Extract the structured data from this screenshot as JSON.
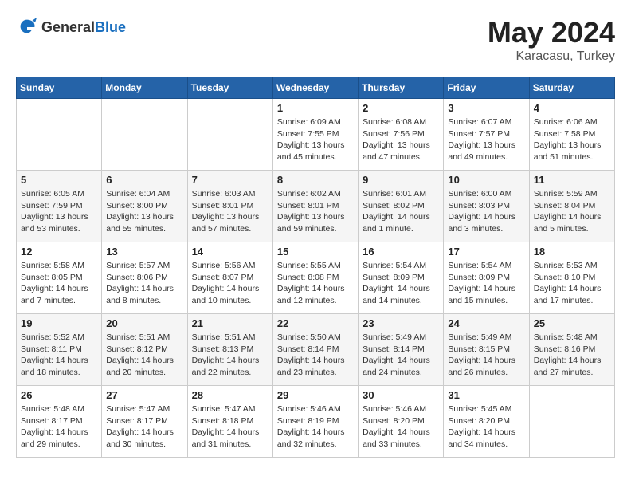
{
  "header": {
    "logo_general": "General",
    "logo_blue": "Blue",
    "title": "May 2024",
    "location": "Karacasu, Turkey"
  },
  "weekdays": [
    "Sunday",
    "Monday",
    "Tuesday",
    "Wednesday",
    "Thursday",
    "Friday",
    "Saturday"
  ],
  "weeks": [
    [
      {
        "day": "",
        "info": ""
      },
      {
        "day": "",
        "info": ""
      },
      {
        "day": "",
        "info": ""
      },
      {
        "day": "1",
        "info": "Sunrise: 6:09 AM\nSunset: 7:55 PM\nDaylight: 13 hours\nand 45 minutes."
      },
      {
        "day": "2",
        "info": "Sunrise: 6:08 AM\nSunset: 7:56 PM\nDaylight: 13 hours\nand 47 minutes."
      },
      {
        "day": "3",
        "info": "Sunrise: 6:07 AM\nSunset: 7:57 PM\nDaylight: 13 hours\nand 49 minutes."
      },
      {
        "day": "4",
        "info": "Sunrise: 6:06 AM\nSunset: 7:58 PM\nDaylight: 13 hours\nand 51 minutes."
      }
    ],
    [
      {
        "day": "5",
        "info": "Sunrise: 6:05 AM\nSunset: 7:59 PM\nDaylight: 13 hours\nand 53 minutes."
      },
      {
        "day": "6",
        "info": "Sunrise: 6:04 AM\nSunset: 8:00 PM\nDaylight: 13 hours\nand 55 minutes."
      },
      {
        "day": "7",
        "info": "Sunrise: 6:03 AM\nSunset: 8:01 PM\nDaylight: 13 hours\nand 57 minutes."
      },
      {
        "day": "8",
        "info": "Sunrise: 6:02 AM\nSunset: 8:01 PM\nDaylight: 13 hours\nand 59 minutes."
      },
      {
        "day": "9",
        "info": "Sunrise: 6:01 AM\nSunset: 8:02 PM\nDaylight: 14 hours\nand 1 minute."
      },
      {
        "day": "10",
        "info": "Sunrise: 6:00 AM\nSunset: 8:03 PM\nDaylight: 14 hours\nand 3 minutes."
      },
      {
        "day": "11",
        "info": "Sunrise: 5:59 AM\nSunset: 8:04 PM\nDaylight: 14 hours\nand 5 minutes."
      }
    ],
    [
      {
        "day": "12",
        "info": "Sunrise: 5:58 AM\nSunset: 8:05 PM\nDaylight: 14 hours\nand 7 minutes."
      },
      {
        "day": "13",
        "info": "Sunrise: 5:57 AM\nSunset: 8:06 PM\nDaylight: 14 hours\nand 8 minutes."
      },
      {
        "day": "14",
        "info": "Sunrise: 5:56 AM\nSunset: 8:07 PM\nDaylight: 14 hours\nand 10 minutes."
      },
      {
        "day": "15",
        "info": "Sunrise: 5:55 AM\nSunset: 8:08 PM\nDaylight: 14 hours\nand 12 minutes."
      },
      {
        "day": "16",
        "info": "Sunrise: 5:54 AM\nSunset: 8:09 PM\nDaylight: 14 hours\nand 14 minutes."
      },
      {
        "day": "17",
        "info": "Sunrise: 5:54 AM\nSunset: 8:09 PM\nDaylight: 14 hours\nand 15 minutes."
      },
      {
        "day": "18",
        "info": "Sunrise: 5:53 AM\nSunset: 8:10 PM\nDaylight: 14 hours\nand 17 minutes."
      }
    ],
    [
      {
        "day": "19",
        "info": "Sunrise: 5:52 AM\nSunset: 8:11 PM\nDaylight: 14 hours\nand 18 minutes."
      },
      {
        "day": "20",
        "info": "Sunrise: 5:51 AM\nSunset: 8:12 PM\nDaylight: 14 hours\nand 20 minutes."
      },
      {
        "day": "21",
        "info": "Sunrise: 5:51 AM\nSunset: 8:13 PM\nDaylight: 14 hours\nand 22 minutes."
      },
      {
        "day": "22",
        "info": "Sunrise: 5:50 AM\nSunset: 8:14 PM\nDaylight: 14 hours\nand 23 minutes."
      },
      {
        "day": "23",
        "info": "Sunrise: 5:49 AM\nSunset: 8:14 PM\nDaylight: 14 hours\nand 24 minutes."
      },
      {
        "day": "24",
        "info": "Sunrise: 5:49 AM\nSunset: 8:15 PM\nDaylight: 14 hours\nand 26 minutes."
      },
      {
        "day": "25",
        "info": "Sunrise: 5:48 AM\nSunset: 8:16 PM\nDaylight: 14 hours\nand 27 minutes."
      }
    ],
    [
      {
        "day": "26",
        "info": "Sunrise: 5:48 AM\nSunset: 8:17 PM\nDaylight: 14 hours\nand 29 minutes."
      },
      {
        "day": "27",
        "info": "Sunrise: 5:47 AM\nSunset: 8:17 PM\nDaylight: 14 hours\nand 30 minutes."
      },
      {
        "day": "28",
        "info": "Sunrise: 5:47 AM\nSunset: 8:18 PM\nDaylight: 14 hours\nand 31 minutes."
      },
      {
        "day": "29",
        "info": "Sunrise: 5:46 AM\nSunset: 8:19 PM\nDaylight: 14 hours\nand 32 minutes."
      },
      {
        "day": "30",
        "info": "Sunrise: 5:46 AM\nSunset: 8:20 PM\nDaylight: 14 hours\nand 33 minutes."
      },
      {
        "day": "31",
        "info": "Sunrise: 5:45 AM\nSunset: 8:20 PM\nDaylight: 14 hours\nand 34 minutes."
      },
      {
        "day": "",
        "info": ""
      }
    ]
  ]
}
